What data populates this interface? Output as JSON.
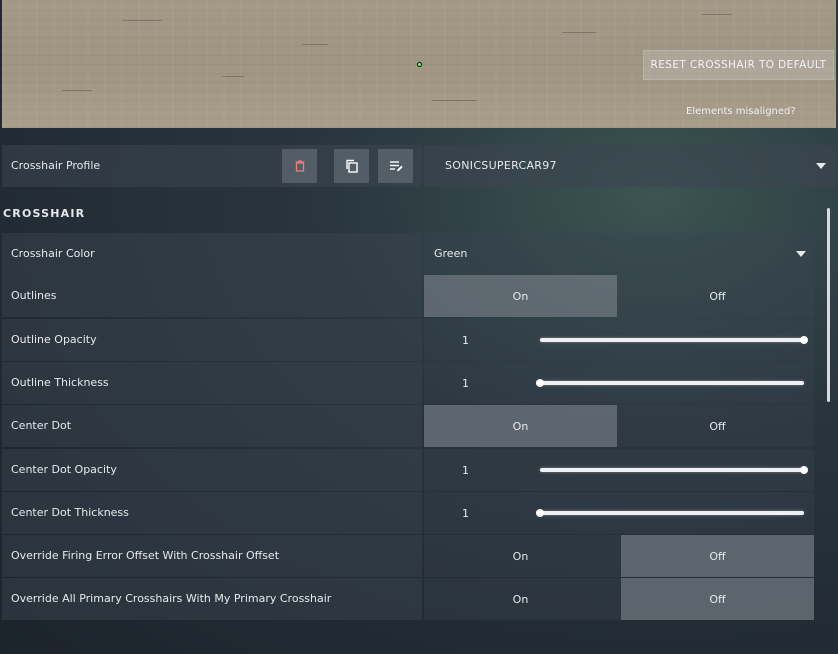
{
  "preview": {
    "reset_label": "RESET CROSSHAIR TO DEFAULT",
    "misaligned_label": "Elements misaligned?"
  },
  "profile": {
    "label": "Crosshair Profile",
    "selected": "SONICSUPERCAR97",
    "icons": [
      "trash-icon",
      "copy-icon",
      "rename-icon"
    ]
  },
  "section": {
    "title": "CROSSHAIR"
  },
  "settings": {
    "crosshair_color": {
      "label": "Crosshair Color",
      "value": "Green"
    },
    "outlines": {
      "label": "Outlines",
      "on": "On",
      "off": "Off",
      "selected": "on"
    },
    "outline_opacity": {
      "label": "Outline Opacity",
      "value": "1",
      "level": 1.0
    },
    "outline_thickness": {
      "label": "Outline Thickness",
      "value": "1",
      "level": 0.0
    },
    "center_dot": {
      "label": "Center Dot",
      "on": "On",
      "off": "Off",
      "selected": "on"
    },
    "center_dot_opacity": {
      "label": "Center Dot Opacity",
      "value": "1",
      "level": 1.0
    },
    "center_dot_thickness": {
      "label": "Center Dot Thickness",
      "value": "1",
      "level": 0.0
    },
    "override_firing_error": {
      "label": "Override Firing Error Offset With Crosshair Offset",
      "on": "On",
      "off": "Off",
      "selected": "off"
    },
    "override_primary": {
      "label": "Override All Primary Crosshairs With My Primary Crosshair",
      "on": "On",
      "off": "Off",
      "selected": "off"
    }
  },
  "colors": {
    "crosshair": "#6dff5c",
    "trash_icon": "#f07a7a"
  }
}
